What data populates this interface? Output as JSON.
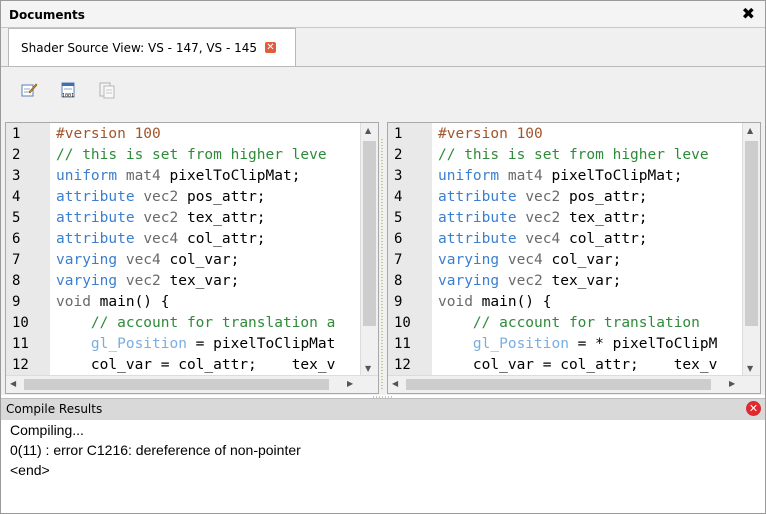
{
  "window": {
    "title": "Documents",
    "close_glyph": "✖"
  },
  "tab": {
    "label": "Shader Source View: VS - 147, VS - 145",
    "close_glyph": "✕"
  },
  "toolbar": {
    "icons": [
      "edit-icon",
      "compile-icon",
      "view-source-icon"
    ]
  },
  "editors": {
    "line_numbers": [
      "1",
      "2",
      "3",
      "4",
      "5",
      "6",
      "7",
      "8",
      "9",
      "10",
      "11",
      "12"
    ],
    "colors": {
      "directive": "#a0552c",
      "comment": "#2e8b3a",
      "keyword": "#3a7fd0",
      "type": "#6a6a6a",
      "builtin": "#7aaee0",
      "plain": "#000000"
    },
    "left": {
      "lines": [
        [
          [
            "directive",
            "#version "
          ],
          [
            "number",
            "100"
          ]
        ],
        [
          [
            "comment",
            "// this is set from higher leve"
          ]
        ],
        [
          [
            "keyword",
            "uniform "
          ],
          [
            "type",
            "mat4"
          ],
          [
            "plain",
            " pixelToClipMat;"
          ]
        ],
        [
          [
            "keyword",
            "attribute "
          ],
          [
            "type",
            "vec2"
          ],
          [
            "plain",
            " pos_attr;"
          ]
        ],
        [
          [
            "keyword",
            "attribute "
          ],
          [
            "type",
            "vec2"
          ],
          [
            "plain",
            " tex_attr;"
          ]
        ],
        [
          [
            "keyword",
            "attribute "
          ],
          [
            "type",
            "vec4"
          ],
          [
            "plain",
            " col_attr;"
          ]
        ],
        [
          [
            "keyword",
            "varying "
          ],
          [
            "type",
            "vec4"
          ],
          [
            "plain",
            " col_var;"
          ]
        ],
        [
          [
            "keyword",
            "varying "
          ],
          [
            "type",
            "vec2"
          ],
          [
            "plain",
            " tex_var;"
          ]
        ],
        [
          [
            "type",
            "void"
          ],
          [
            "plain",
            " main() {"
          ]
        ],
        [
          [
            "plain",
            "    "
          ],
          [
            "comment",
            "// account for translation a"
          ]
        ],
        [
          [
            "plain",
            "    "
          ],
          [
            "builtin",
            "gl_Position"
          ],
          [
            "plain",
            " = pixelToClipMat"
          ]
        ],
        [
          [
            "plain",
            "    col_var = col_attr;    tex_v"
          ]
        ]
      ]
    },
    "right": {
      "lines": [
        [
          [
            "directive",
            "#version "
          ],
          [
            "number",
            "100"
          ]
        ],
        [
          [
            "comment",
            "// this is set from higher leve"
          ]
        ],
        [
          [
            "keyword",
            "uniform "
          ],
          [
            "type",
            "mat4"
          ],
          [
            "plain",
            " pixelToClipMat;"
          ]
        ],
        [
          [
            "keyword",
            "attribute "
          ],
          [
            "type",
            "vec2"
          ],
          [
            "plain",
            " pos_attr;"
          ]
        ],
        [
          [
            "keyword",
            "attribute "
          ],
          [
            "type",
            "vec2"
          ],
          [
            "plain",
            " tex_attr;"
          ]
        ],
        [
          [
            "keyword",
            "attribute "
          ],
          [
            "type",
            "vec4"
          ],
          [
            "plain",
            " col_attr;"
          ]
        ],
        [
          [
            "keyword",
            "varying "
          ],
          [
            "type",
            "vec4"
          ],
          [
            "plain",
            " col_var;"
          ]
        ],
        [
          [
            "keyword",
            "varying "
          ],
          [
            "type",
            "vec2"
          ],
          [
            "plain",
            " tex_var;"
          ]
        ],
        [
          [
            "type",
            "void"
          ],
          [
            "plain",
            " main() {"
          ]
        ],
        [
          [
            "plain",
            "    "
          ],
          [
            "comment",
            "// account for translation "
          ]
        ],
        [
          [
            "plain",
            "    "
          ],
          [
            "builtin",
            "gl_Position"
          ],
          [
            "plain",
            " = * pixelToClipM"
          ]
        ],
        [
          [
            "plain",
            "    col_var = col_attr;    tex_v"
          ]
        ]
      ]
    }
  },
  "compile": {
    "title": "Compile Results",
    "error_glyph": "✕",
    "output": [
      "Compiling...",
      "0(11) : error C1216: dereference of non-pointer",
      "<end>"
    ]
  }
}
